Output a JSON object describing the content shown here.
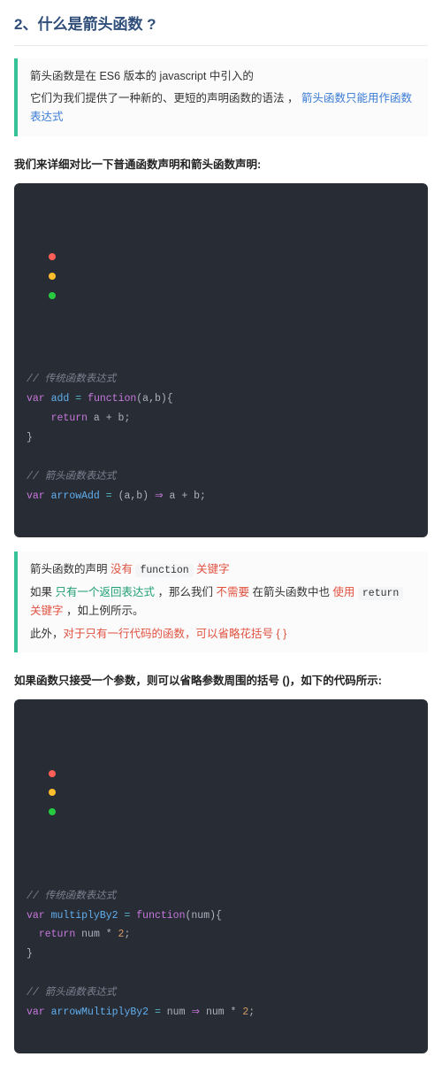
{
  "heading": "2、什么是箭头函数 ?",
  "callout1": {
    "line1": "箭头函数是在 ES6 版本的 javascript 中引入的",
    "line2_a": "它们为我们提供了一种新的、更短的声明函数的语法 ，",
    "line2_b": "箭头函数只能用作函数表达式"
  },
  "lead1": "我们来详细对比一下普通函数声明和箭头函数声明:",
  "code1": {
    "c1": "// 传统函数表达式",
    "l2": {
      "kw": "var",
      "name": "add",
      "eq": " = ",
      "fn": "function",
      "params": "(a,b)",
      "brace": "{"
    },
    "l3": {
      "kw": "return",
      "body": " a + b;"
    },
    "l4": "}",
    "c2": "// 箭头函数表达式",
    "l6": {
      "kw": "var",
      "name": "arrowAdd",
      "eq": " = ",
      "params": "(a,b)",
      "arrow": " ⇒ ",
      "body": "a + b",
      "semi": ";"
    }
  },
  "callout2": {
    "p1_a": "箭头函数的声明 ",
    "p1_b": "没有 ",
    "p1_c": "function",
    "p1_d": " 关键字",
    "p2_a": "如果 ",
    "p2_b": "只有一个返回表达式",
    "p2_c": " ，那么我们 ",
    "p2_d": "不需要",
    "p2_e": " 在箭头函数中也 ",
    "p2_f": "使用 ",
    "p2_g": "return",
    "p2_h": " 关键字",
    "p2_i": " ，如上例所示。",
    "p3_a": "此外，",
    "p3_b": "对于只有一行代码的函数，可以省略花括号 { }"
  },
  "lead2": "如果函数只接受一个参数，则可以省略参数周围的括号 ()，如下的代码所示:",
  "code2": {
    "c1": "// 传统函数表达式",
    "l2": {
      "kw": "var",
      "name": "multiplyBy2",
      "eq": " = ",
      "fn": "function",
      "params": "(num)",
      "brace": "{"
    },
    "l3": {
      "kw": "return",
      "body": " num * ",
      "num": "2",
      "semi": ";"
    },
    "l4": "}",
    "c2": "// 箭头函数表达式",
    "l6": {
      "kw": "var",
      "name": "arrowMultiplyBy2",
      "eq": " = ",
      "p": "num",
      "arrow": " ⇒ ",
      "body": "num * ",
      "num": "2",
      "semi": ";"
    }
  }
}
